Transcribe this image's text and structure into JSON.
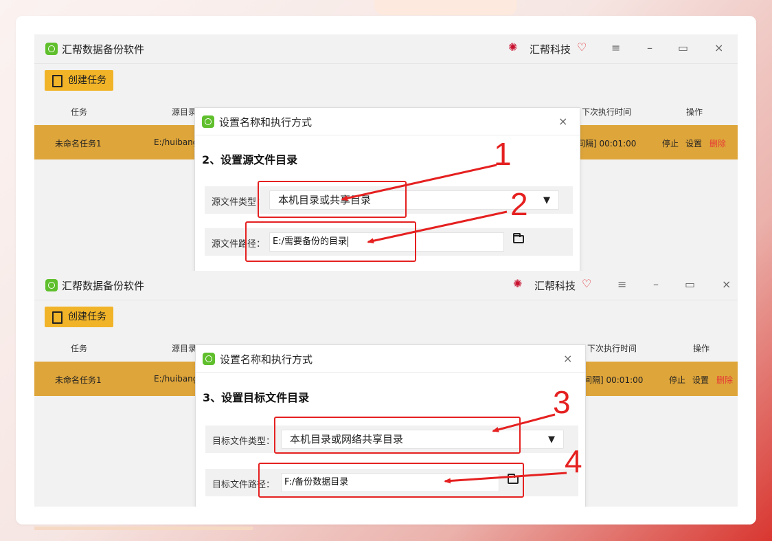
{
  "app": {
    "title": "汇帮数据备份软件",
    "brand": "汇帮科技"
  },
  "toolbar": {
    "create_label": "创建任务"
  },
  "table": {
    "headers": {
      "task": "任务",
      "source": "源目录",
      "next_time": "下次执行时间",
      "actions": "操作"
    },
    "row": {
      "name": "未命名任务1",
      "source": "E:/huibang",
      "next_time": "间隔] 00:01:00",
      "stop": "停止",
      "settings": "设置",
      "delete": "删除"
    }
  },
  "dialog1": {
    "title": "设置名称和执行方式",
    "step": "2、设置源文件目录",
    "type_label": "源文件类型：",
    "type_value": "本机目录或共享目录",
    "path_label": "源文件路径：",
    "path_value": "E:/需要备份的目录"
  },
  "dialog2": {
    "title": "设置名称和执行方式",
    "step": "3、设置目标文件目录",
    "type_label": "目标文件类型：",
    "type_value": "本机目录或网络共享目录",
    "path_label": "目标文件路径：",
    "path_value": "F:/备份数据目录"
  },
  "annotations": {
    "n1": "1",
    "n2": "2",
    "n3": "3",
    "n4": "4"
  },
  "icons": {
    "close": "close-icon",
    "minimize": "minimize-icon",
    "maximize": "maximize-icon",
    "menu": "menu-icon",
    "folder": "folder-icon"
  },
  "colors": {
    "accent": "#f1b428",
    "row_highlight": "#dea53a",
    "annotation": "#e52020",
    "danger": "#e53935",
    "logo": "#5fbf2c"
  }
}
